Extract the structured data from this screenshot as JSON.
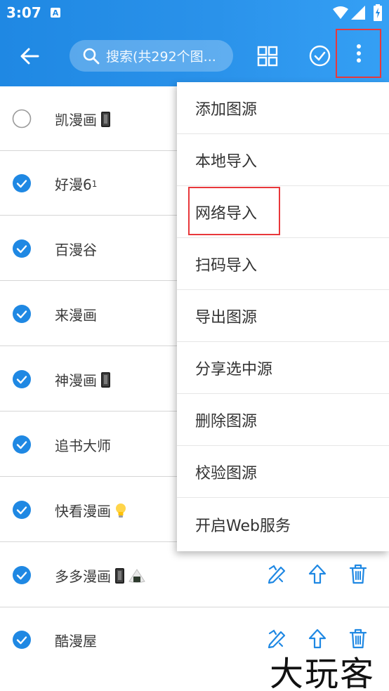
{
  "status": {
    "time": "3:07",
    "notif_letter": "A"
  },
  "appbar": {
    "search_placeholder": "搜索(共292个图..."
  },
  "colors": {
    "accent": "#1f88e3",
    "check_blue": "#1f88e3",
    "highlight_red": "#e8383b"
  },
  "list": [
    {
      "name": "凯漫画",
      "emoji": "phone",
      "checked": false,
      "actions": false
    },
    {
      "name": "好漫6",
      "sub": "1",
      "checked": true,
      "actions": false
    },
    {
      "name": "百漫谷",
      "checked": true,
      "actions": false
    },
    {
      "name": "来漫画",
      "checked": true,
      "actions": false
    },
    {
      "name": "神漫画",
      "emoji": "phone",
      "checked": true,
      "actions": false
    },
    {
      "name": "追书大师",
      "checked": true,
      "actions": false
    },
    {
      "name": "快看漫画",
      "emoji": "bulb",
      "checked": true,
      "actions": false
    },
    {
      "name": "多多漫画",
      "emoji": "phone-rice",
      "checked": true,
      "actions": true
    },
    {
      "name": "酷漫屋",
      "checked": true,
      "actions": true
    }
  ],
  "menu": {
    "items": [
      "添加图源",
      "本地导入",
      "网络导入",
      "扫码导入",
      "导出图源",
      "分享选中源",
      "删除图源",
      "校验图源",
      "开启Web服务"
    ],
    "highlighted_index": 2
  },
  "watermark": "大玩客"
}
